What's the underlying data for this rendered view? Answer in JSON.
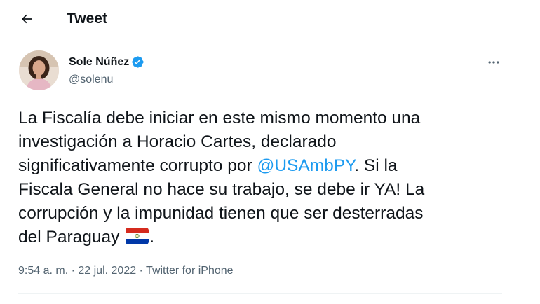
{
  "header": {
    "title": "Tweet"
  },
  "author": {
    "name": "Sole Núñez",
    "handle": "@solenu",
    "verified": true
  },
  "tweet": {
    "text_part1": "La Fiscalía debe iniciar en este mismo momento una\ninvestigación a Horacio Cartes, declarado\nsignificativamente corrupto por ",
    "mention": "@USAmbPY",
    "text_part2": ". Si la\nFiscala General no hace su trabajo, se debe ir YA! La\ncorrupción y la impunidad tienen que ser desterradas\ndel Paraguay ",
    "emoji": "flag-paraguay-icon",
    "text_part3": "."
  },
  "meta": {
    "time": "9:54 a. m.",
    "sep1": " · ",
    "date": "22 jul. 2022",
    "sep2": " · ",
    "source": "Twitter for iPhone"
  },
  "colors": {
    "accent": "#1d9bf0",
    "text": "#0f1419",
    "secondary": "#536471",
    "border": "#eff3f4"
  }
}
